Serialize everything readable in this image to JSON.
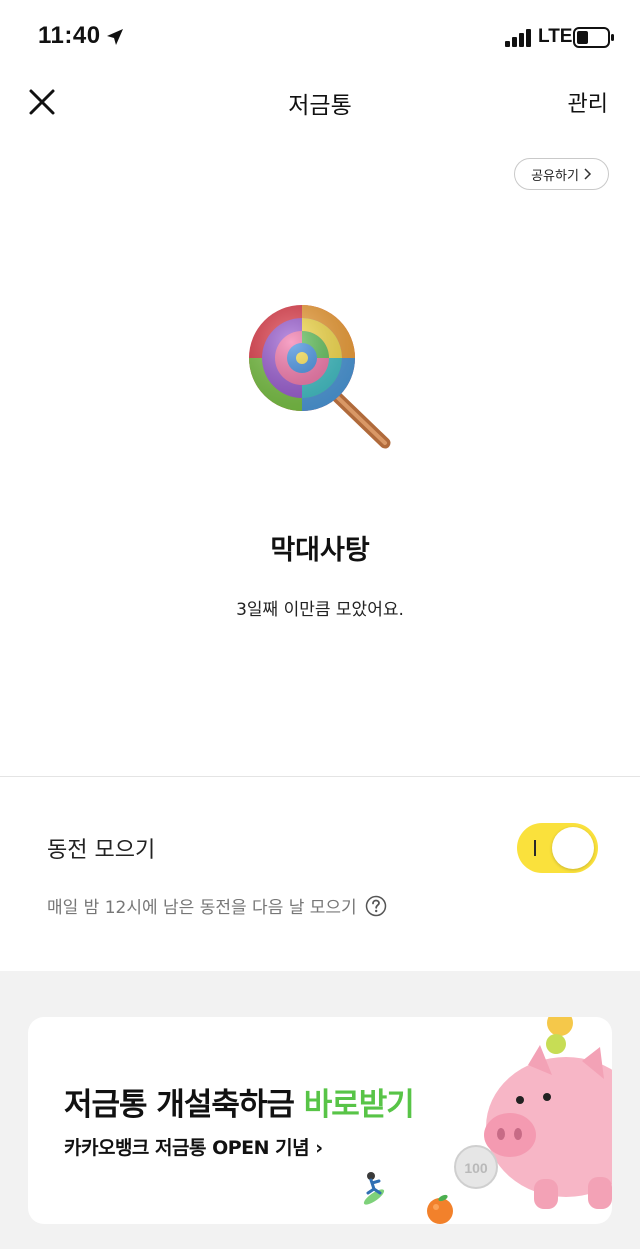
{
  "status_bar": {
    "time": "11:40",
    "network": "LTE"
  },
  "nav": {
    "title": "저금통",
    "manage_label": "관리"
  },
  "share": {
    "label": "공유하기"
  },
  "jar": {
    "icon": "lollipop-icon",
    "name": "막대사탕",
    "subtitle": "3일째 이만큼 모았어요."
  },
  "coin_saving": {
    "label": "동전 모으기",
    "enabled": true,
    "description": "매일 밤 12시에 남은 동전을 다음 날 모으기"
  },
  "banner": {
    "title_main": "저금통 개설축하금 ",
    "title_highlight": "바로받기",
    "subtitle": "카카오뱅크 저금통 OPEN 기념",
    "highlight_color": "#58c447",
    "coin_text": "100"
  },
  "colors": {
    "toggle_on": "#fae13c",
    "background_gray": "#f2f2f2"
  }
}
